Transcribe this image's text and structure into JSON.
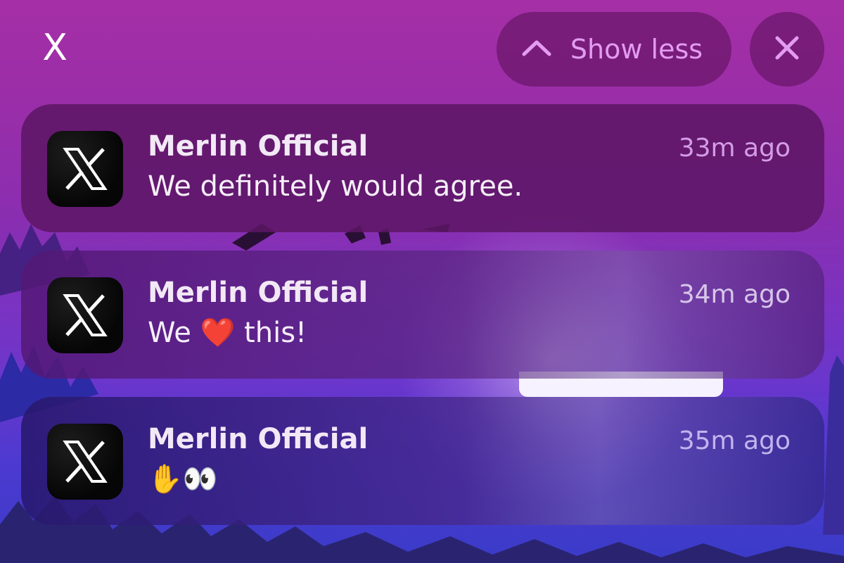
{
  "top_bar": {
    "app_glyph": "X",
    "show_less_label": "Show less",
    "icons": {
      "show_less": "chevron-up-icon",
      "close": "close-icon"
    }
  },
  "notifications": [
    {
      "app_icon": "x-logo-icon",
      "sender": "Merlin Official",
      "time": "33m ago",
      "message": "We definitely would agree."
    },
    {
      "app_icon": "x-logo-icon",
      "sender": "Merlin Official",
      "time": "34m ago",
      "message": "We ❤️ this!"
    },
    {
      "app_icon": "x-logo-icon",
      "sender": "Merlin Official",
      "time": "35m ago",
      "message": "✋👀"
    }
  ],
  "colors": {
    "background_top": "#a52fa6",
    "background_bottom": "#3a3bc8",
    "pill": "#691669",
    "accent_text": "#e39cf0"
  }
}
